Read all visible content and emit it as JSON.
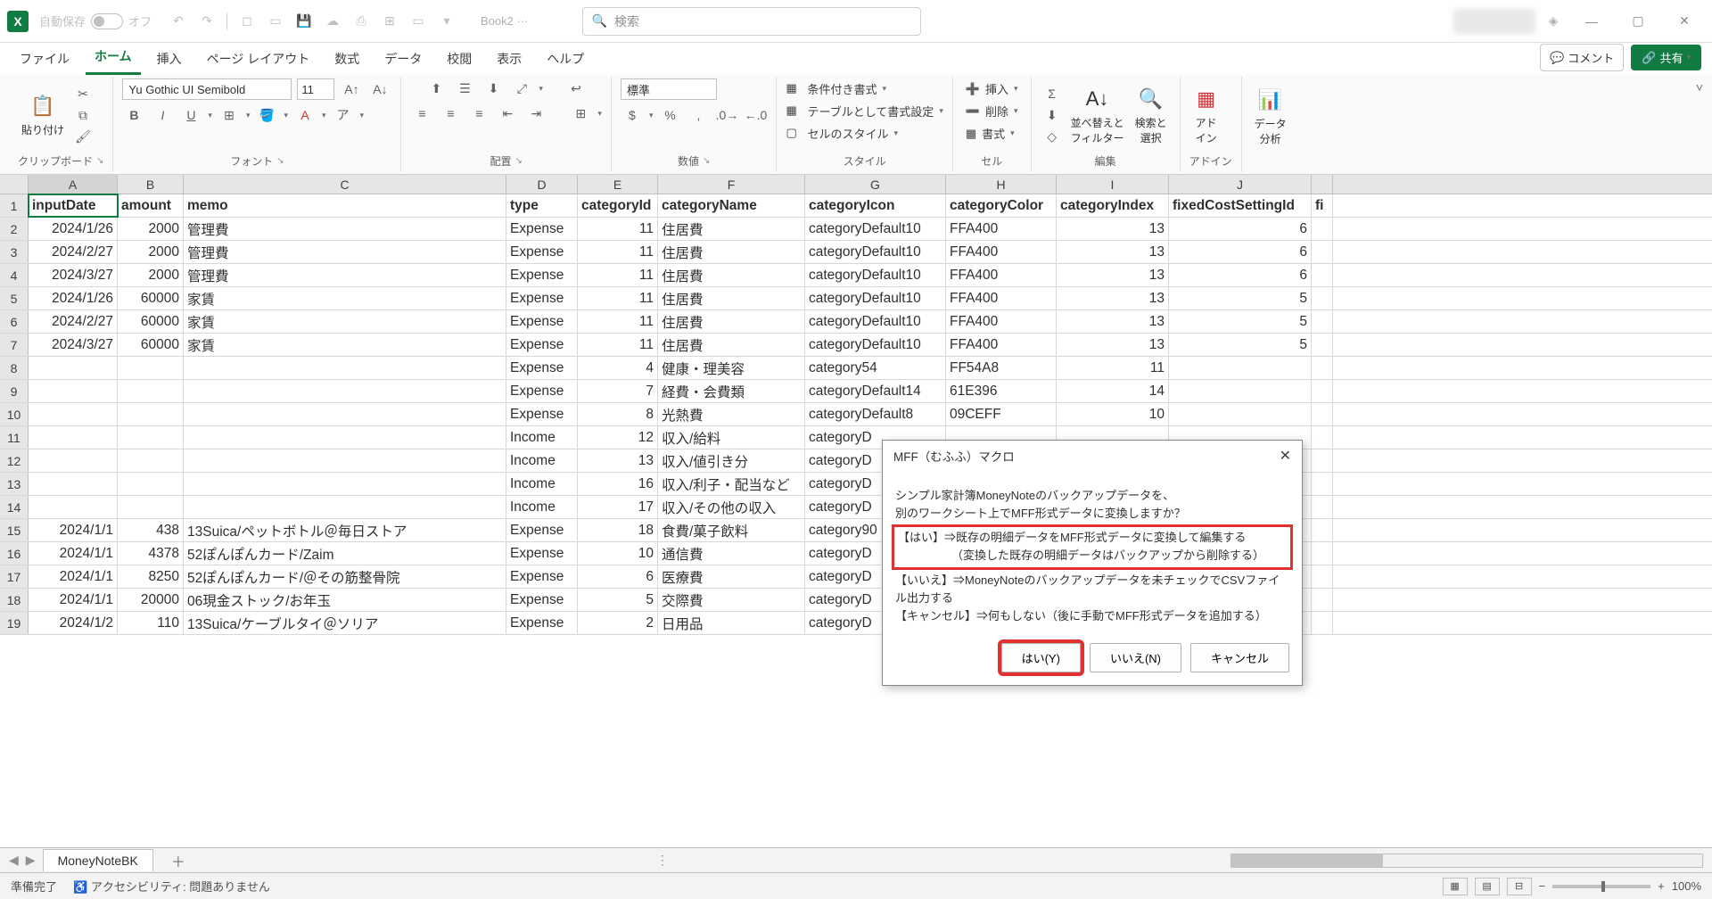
{
  "titlebar": {
    "autosave_label": "自動保存",
    "autosave_state": "オフ",
    "doc_name": "Book2",
    "doc_dirty": "···",
    "search_placeholder": "検索"
  },
  "tabs": {
    "items": [
      "ファイル",
      "ホーム",
      "挿入",
      "ページ レイアウト",
      "数式",
      "データ",
      "校閲",
      "表示",
      "ヘルプ"
    ],
    "active": 1,
    "comment_btn": "コメント",
    "share_btn": "共有"
  },
  "ribbon": {
    "clipboard": {
      "paste": "貼り付け",
      "label": "クリップボード"
    },
    "font": {
      "name": "Yu Gothic UI Semibold",
      "size": "11",
      "label": "フォント"
    },
    "align": {
      "label": "配置"
    },
    "number": {
      "format": "標準",
      "label": "数値"
    },
    "styles": {
      "cond_fmt": "条件付き書式",
      "as_table": "テーブルとして書式設定",
      "cell_styles": "セルのスタイル",
      "label": "スタイル"
    },
    "cells": {
      "insert": "挿入",
      "delete": "削除",
      "format": "書式",
      "label": "セル"
    },
    "editing": {
      "sort": "並べ替えと\nフィルター",
      "find": "検索と\n選択",
      "label": "編集"
    },
    "addins": {
      "addins": "アド\nイン",
      "label": "アドイン"
    },
    "analysis": {
      "analysis": "データ\n分析"
    }
  },
  "columns": [
    "A",
    "B",
    "C",
    "D",
    "E",
    "F",
    "G",
    "H",
    "I",
    "J"
  ],
  "grid": {
    "headers": [
      "inputDate",
      "amount",
      "memo",
      "type",
      "categoryId",
      "categoryName",
      "categoryIcon",
      "categoryColor",
      "categoryIndex",
      "fixedCostSettingId",
      "fi"
    ],
    "rows": [
      {
        "n": 2,
        "A": "2024/1/26",
        "B": "2000",
        "C": "管理費",
        "D": "Expense",
        "E": "11",
        "F": "住居費",
        "G": "categoryDefault10",
        "H": "FFA400",
        "I": "13",
        "J": "6"
      },
      {
        "n": 3,
        "A": "2024/2/27",
        "B": "2000",
        "C": "管理費",
        "D": "Expense",
        "E": "11",
        "F": "住居費",
        "G": "categoryDefault10",
        "H": "FFA400",
        "I": "13",
        "J": "6"
      },
      {
        "n": 4,
        "A": "2024/3/27",
        "B": "2000",
        "C": "管理費",
        "D": "Expense",
        "E": "11",
        "F": "住居費",
        "G": "categoryDefault10",
        "H": "FFA400",
        "I": "13",
        "J": "6"
      },
      {
        "n": 5,
        "A": "2024/1/26",
        "B": "60000",
        "C": "家賃",
        "D": "Expense",
        "E": "11",
        "F": "住居費",
        "G": "categoryDefault10",
        "H": "FFA400",
        "I": "13",
        "J": "5"
      },
      {
        "n": 6,
        "A": "2024/2/27",
        "B": "60000",
        "C": "家賃",
        "D": "Expense",
        "E": "11",
        "F": "住居費",
        "G": "categoryDefault10",
        "H": "FFA400",
        "I": "13",
        "J": "5"
      },
      {
        "n": 7,
        "A": "2024/3/27",
        "B": "60000",
        "C": "家賃",
        "D": "Expense",
        "E": "11",
        "F": "住居費",
        "G": "categoryDefault10",
        "H": "FFA400",
        "I": "13",
        "J": "5"
      },
      {
        "n": 8,
        "A": "",
        "B": "",
        "C": "",
        "D": "Expense",
        "E": "4",
        "F": "健康・理美容",
        "G": "category54",
        "H": "FF54A8",
        "I": "11",
        "J": ""
      },
      {
        "n": 9,
        "A": "",
        "B": "",
        "C": "",
        "D": "Expense",
        "E": "7",
        "F": "経費・会費類",
        "G": "categoryDefault14",
        "H": "61E396",
        "I": "14",
        "J": ""
      },
      {
        "n": 10,
        "A": "",
        "B": "",
        "C": "",
        "D": "Expense",
        "E": "8",
        "F": "光熱費",
        "G": "categoryDefault8",
        "H": "09CEFF",
        "I": "10",
        "J": ""
      },
      {
        "n": 11,
        "A": "",
        "B": "",
        "C": "",
        "D": "Income",
        "E": "12",
        "F": "収入/給料",
        "G": "categoryD",
        "H": "",
        "I": "",
        "J": ""
      },
      {
        "n": 12,
        "A": "",
        "B": "",
        "C": "",
        "D": "Income",
        "E": "13",
        "F": "収入/値引き分",
        "G": "categoryD",
        "H": "",
        "I": "",
        "J": ""
      },
      {
        "n": 13,
        "A": "",
        "B": "",
        "C": "",
        "D": "Income",
        "E": "16",
        "F": "収入/利子・配当など",
        "G": "categoryD",
        "H": "",
        "I": "",
        "J": ""
      },
      {
        "n": 14,
        "A": "",
        "B": "",
        "C": "",
        "D": "Income",
        "E": "17",
        "F": "収入/その他の収入",
        "G": "categoryD",
        "H": "",
        "I": "",
        "J": ""
      },
      {
        "n": 15,
        "A": "2024/1/1",
        "B": "438",
        "C": "13Suica/ペットボトル＠毎日ストア",
        "D": "Expense",
        "E": "18",
        "F": "食費/菓子飲料",
        "G": "category90",
        "H": "",
        "I": "",
        "J": ""
      },
      {
        "n": 16,
        "A": "2024/1/1",
        "B": "4378",
        "C": "52ぽんぽんカード/Zaim",
        "D": "Expense",
        "E": "10",
        "F": "通信費",
        "G": "categoryD",
        "H": "",
        "I": "",
        "J": ""
      },
      {
        "n": 17,
        "A": "2024/1/1",
        "B": "8250",
        "C": "52ぽんぽんカード/＠その筋整骨院",
        "D": "Expense",
        "E": "6",
        "F": "医療費",
        "G": "categoryD",
        "H": "",
        "I": "",
        "J": ""
      },
      {
        "n": 18,
        "A": "2024/1/1",
        "B": "20000",
        "C": "06現金ストック/お年玉",
        "D": "Expense",
        "E": "5",
        "F": "交際費",
        "G": "categoryD",
        "H": "",
        "I": "",
        "J": ""
      },
      {
        "n": 19,
        "A": "2024/1/2",
        "B": "110",
        "C": "13Suica/ケーブルタイ＠ソリア",
        "D": "Expense",
        "E": "2",
        "F": "日用品",
        "G": "categoryD",
        "H": "",
        "I": "",
        "J": ""
      }
    ]
  },
  "sheets": {
    "active": "MoneyNoteBK"
  },
  "status": {
    "ready": "準備完了",
    "a11y": "アクセシビリティ: 問題ありません",
    "zoom": "100%"
  },
  "dialog": {
    "title": "MFF（むふふ）マクロ",
    "line1": "シンプル家計簿MoneyNoteのバックアップデータを、",
    "line2": "別のワークシート上でMFF形式データに変換しますか？",
    "hl1": "【はい】⇒既存の明細データをMFF形式データに変換して編集する",
    "hl2": "（変換した既存の明細データはバックアップから削除する）",
    "line3": "【いいえ】⇒MoneyNoteのバックアップデータを未チェックでCSVファイル出力する",
    "line4": "【キャンセル】⇒何もしない（後に手動でMFF形式データを追加する）",
    "yes": "はい(Y)",
    "no": "いいえ(N)",
    "cancel": "キャンセル"
  }
}
